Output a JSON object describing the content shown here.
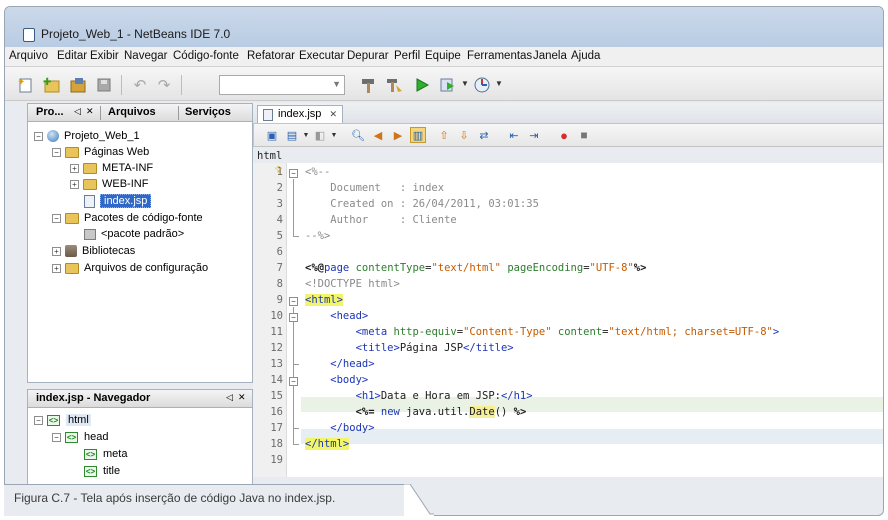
{
  "window": {
    "title": "Projeto_Web_1 - NetBeans IDE 7.0"
  },
  "menu": [
    "Arquivo",
    "Editar",
    "Exibir",
    "Navegar",
    "Código-fonte",
    "Refatorar",
    "Executar",
    "Depurar",
    "Perfil",
    "Equipe",
    "Ferramentas",
    "Janela",
    "Ajuda"
  ],
  "project_pane": {
    "tabs": [
      "Pro...",
      "Arquivos",
      "Serviços"
    ],
    "tree": {
      "project": "Projeto_Web_1",
      "web_pages": "Páginas Web",
      "meta_inf": "META-INF",
      "web_inf": "WEB-INF",
      "index_file": "index.jsp",
      "source_packages": "Pacotes de código-fonte",
      "default_package": "<pacote padrão>",
      "libraries": "Bibliotecas",
      "config_files": "Arquivos de configuração"
    }
  },
  "navigator": {
    "title": "index.jsp - Navegador",
    "items": {
      "html": "html",
      "head": "head",
      "meta": "meta",
      "title": "title"
    }
  },
  "editor": {
    "tab_label": "index.jsp",
    "breadcrumb": "html",
    "line_numbers": [
      "1",
      "2",
      "3",
      "4",
      "5",
      "6",
      "7",
      "8",
      "9",
      "10",
      "11",
      "12",
      "13",
      "14",
      "15",
      "16",
      "17",
      "18",
      "19"
    ],
    "lines": {
      "l1": "<%--",
      "l2": "    Document   : index",
      "l3": "    Created on : 26/04/2011, 03:01:35",
      "l4": "    Author     : Cliente",
      "l5": "--%>",
      "l7_open": "<%@",
      "l7_page": "page",
      "l7_attr1": " contentType",
      "l7_eq1": "=",
      "l7_val1": "\"text/html\"",
      "l7_attr2": " pageEncoding",
      "l7_eq2": "=",
      "l7_val2": "\"UTF-8\"",
      "l7_close": "%>",
      "l8": "<!DOCTYPE html>",
      "l9": "<html>",
      "l10": "    <head>",
      "l11_tag": "        <meta",
      "l11_attr1": " http-equiv",
      "l11_val1": "\"Content-Type\"",
      "l11_attr2": " content",
      "l11_val2": "\"text/html; charset=UTF-8\"",
      "l11_close": ">",
      "l12_open": "        <title>",
      "l12_text": "Página JSP",
      "l12_close": "</title>",
      "l13": "    </head>",
      "l14": "    <body>",
      "l15_open": "        <h1>",
      "l15_text": "Data e Hora em JSP:",
      "l15_close": "</h1>",
      "l16_open": "        <%=",
      "l16_new": " new",
      "l16_pkg": " java.util.",
      "l16_date": "Date",
      "l16_rest": "() ",
      "l16_close": "%>",
      "l17": "    </body>",
      "l18": "</html>"
    }
  },
  "caption": "Figura C.7 - Tela após inserção de código Java no index.jsp."
}
